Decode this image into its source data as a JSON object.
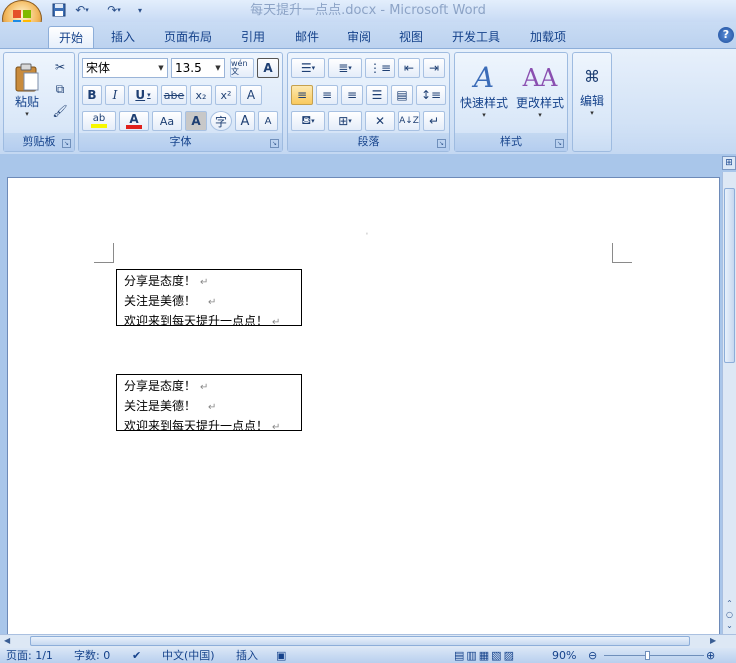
{
  "window": {
    "title": "每天提升一点点.docx - Microsoft Word"
  },
  "tabs": [
    {
      "label": "开始",
      "active": true
    },
    {
      "label": "插入"
    },
    {
      "label": "页面布局"
    },
    {
      "label": "引用"
    },
    {
      "label": "邮件"
    },
    {
      "label": "审阅"
    },
    {
      "label": "视图"
    },
    {
      "label": "开发工具"
    },
    {
      "label": "加载项"
    }
  ],
  "help": {
    "glyph": "?"
  },
  "ribbon": {
    "clipboard": {
      "label": "剪贴板",
      "paste_label": "粘贴"
    },
    "font": {
      "label": "字体",
      "font_name": "宋体",
      "font_size": "13.5",
      "bold": "B",
      "italic": "I",
      "underline": "U",
      "strike": "abe",
      "subscript": "x₂",
      "superscript": "x²",
      "clear_format": "A",
      "change_case": "Aa",
      "grow": "A",
      "shrink": "A",
      "phonetic": "wén 文",
      "border_char": "A",
      "enclose_char": "字",
      "highlight": "ab",
      "font_color": "A",
      "highlight_color": "#f7f700",
      "font_color_value": "#e0201b"
    },
    "paragraph": {
      "label": "段落"
    },
    "styles": {
      "label": "样式",
      "quick_styles": "快速样式",
      "change_styles": "更改样式"
    },
    "editing": {
      "label": "编辑"
    }
  },
  "document": {
    "text_boxes": [
      {
        "lines": [
          "分享是态度！",
          "关注是美德！",
          "欢迎来到每天提升一点点！"
        ]
      },
      {
        "lines": [
          "分享是态度！",
          "关注是美德！",
          "欢迎来到每天提升一点点！"
        ]
      }
    ]
  },
  "status": {
    "page": "页面: 1/1",
    "words": "字数: 0",
    "language": "中文(中国)",
    "mode": "插入",
    "zoom": "90%"
  }
}
